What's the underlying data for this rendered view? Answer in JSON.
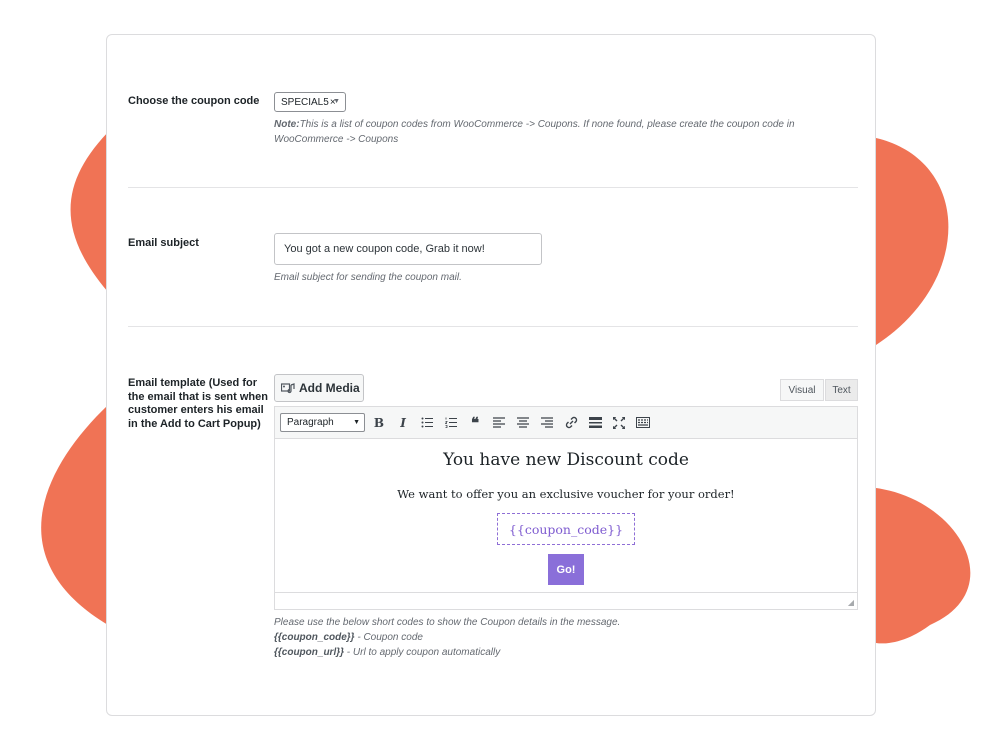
{
  "coupon_section": {
    "label": "Choose the coupon code",
    "selected_code": "SPECIAL5",
    "remove_glyph": "×",
    "note_prefix": "Note:",
    "note_line1": "This is a list of coupon codes from WooCommerce -> Coupons. If none found, please create the coupon code in",
    "note_line2": "WooCommerce -> Coupons"
  },
  "subject_section": {
    "label": "Email subject",
    "value": "You got a new coupon code, Grab it now!",
    "description": "Email subject for sending the coupon mail."
  },
  "template_section": {
    "label_lines": [
      "Email template (Used for",
      "the email that is sent when",
      "customer enters his email",
      "in the Add to Cart Popup)"
    ],
    "add_media_label": "Add Media",
    "tab_visual": "Visual",
    "tab_text": "Text",
    "format_select": "Paragraph",
    "toolbar_icons": [
      "bold-icon",
      "italic-icon",
      "bullet-list-icon",
      "numbered-list-icon",
      "blockquote-icon",
      "align-left-icon",
      "align-center-icon",
      "align-right-icon",
      "link-icon",
      "horizontal-line-icon",
      "fullscreen-icon",
      "toolbar-toggle-icon"
    ],
    "content": {
      "heading": "You have new Discount code",
      "paragraph": "We want to offer you an exclusive voucher for your order!",
      "coupon_placeholder": "{{coupon_code}}",
      "button_label": "Go!"
    },
    "help_line": "Please use the below short codes to show the Coupon details in the message.",
    "shortcode1": "{{coupon_code}}",
    "shortcode1_desc": " - Coupon code",
    "shortcode2": "{{coupon_url}}",
    "shortcode2_desc": " - Url to apply coupon automatically"
  },
  "colors": {
    "blob": "#f07355",
    "accent_purple": "#8a6fd9",
    "border": "#dcdcde"
  }
}
